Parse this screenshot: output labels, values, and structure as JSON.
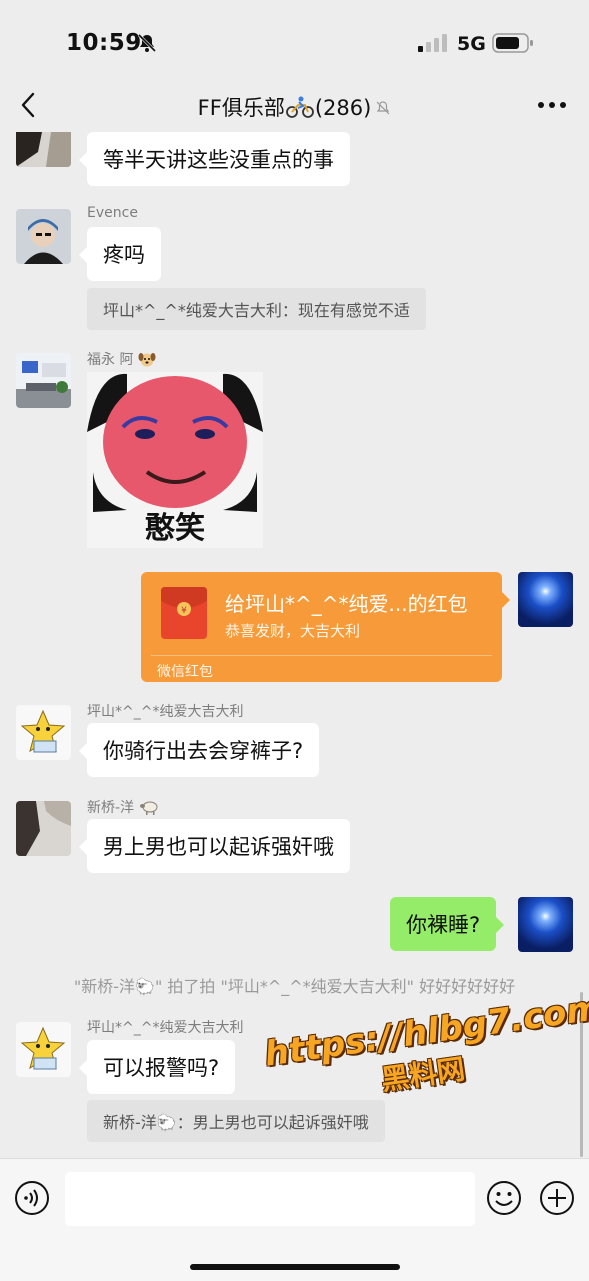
{
  "status_bar": {
    "time": "10:59",
    "network": "5G"
  },
  "nav": {
    "title": "FF俱乐部",
    "member_count": "(286)"
  },
  "messages": {
    "m1": {
      "text": "等半天讲这些没重点的事"
    },
    "m2": {
      "sender": "Evence",
      "text": "疼吗",
      "quote": "坪山*^_^*纯爱大吉大利：现在有感觉不适"
    },
    "m3": {
      "sender": "福永 阿",
      "sticker_caption": "憨笑"
    },
    "m4": {
      "title": "给坪山*^_^*纯爱...的红包",
      "subtitle": "恭喜发财，大吉大利",
      "footer": "微信红包"
    },
    "m5": {
      "sender": "坪山*^_^*纯爱大吉大利",
      "text": "你骑行出去会穿裤子?"
    },
    "m6": {
      "sender": "新桥-洋",
      "text": "男上男也可以起诉强奸哦"
    },
    "m7": {
      "text": "你裸睡?"
    },
    "sys1": {
      "text": "\"新桥-洋🐑\" 拍了拍 \"坪山*^_^*纯爱大吉大利\" 好好好好好好"
    },
    "m8": {
      "sender": "坪山*^_^*纯爱大吉大利",
      "text": "可以报警吗?",
      "quote": "新桥-洋🐑：男上男也可以起诉强奸哦"
    }
  },
  "watermark": {
    "line1": "https://hlbg7.com",
    "line2": "黑料网"
  },
  "icons": [
    "bell-off-icon",
    "signal-icon",
    "battery-icon",
    "back-icon",
    "bike-icon",
    "mute-icon",
    "more-icon",
    "red-packet-icon",
    "voice-icon",
    "emoji-icon",
    "plus-icon"
  ],
  "colors": {
    "background": "#ededed",
    "green_bubble": "#95ec69",
    "red_packet": "#f79b3a"
  }
}
